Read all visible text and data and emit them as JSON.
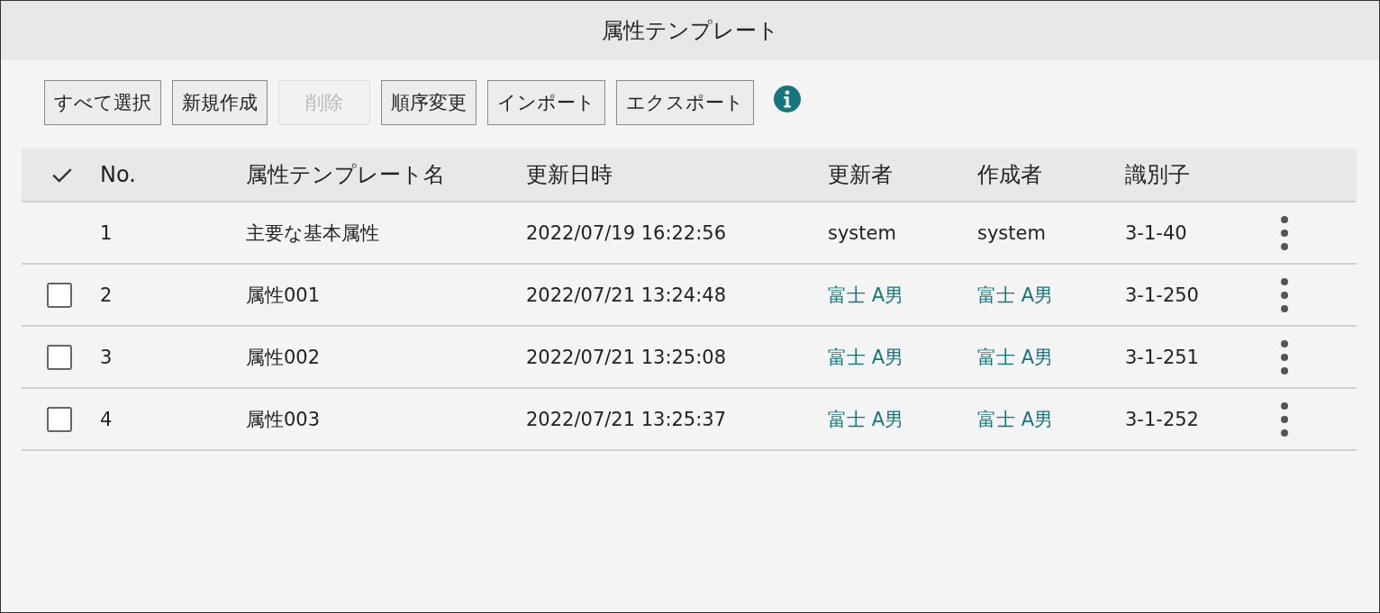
{
  "window": {
    "title": "属性テンプレート"
  },
  "toolbar": {
    "buttons": [
      {
        "label": "すべて選択",
        "disabled": false
      },
      {
        "label": "新規作成",
        "disabled": false
      },
      {
        "label": "削除",
        "disabled": true
      },
      {
        "label": "順序変更",
        "disabled": false
      },
      {
        "label": "インポート",
        "disabled": false
      },
      {
        "label": "エクスポート",
        "disabled": false
      }
    ]
  },
  "table": {
    "columns": [
      "No.",
      "属性テンプレート名",
      "更新日時",
      "更新者",
      "作成者",
      "識別子"
    ],
    "rows": [
      {
        "kind": "system",
        "cells": [
          "1",
          "主要な基本属性",
          "2022/07/19 16:22:56",
          "system",
          "system",
          "3-1-40"
        ]
      },
      {
        "kind": "user",
        "checked": false,
        "cells": [
          "2",
          "属性001",
          "2022/07/21 13:24:48",
          "富士 A男",
          "富士 A男",
          "3-1-250"
        ]
      },
      {
        "kind": "user",
        "checked": false,
        "cells": [
          "3",
          "属性002",
          "2022/07/21 13:25:08",
          "富士 A男",
          "富士 A男",
          "3-1-251"
        ]
      },
      {
        "kind": "user",
        "checked": false,
        "cells": [
          "4",
          "属性003",
          "2022/07/21 13:25:37",
          "富士 A男",
          "富士 A男",
          "3-1-252"
        ]
      }
    ]
  }
}
